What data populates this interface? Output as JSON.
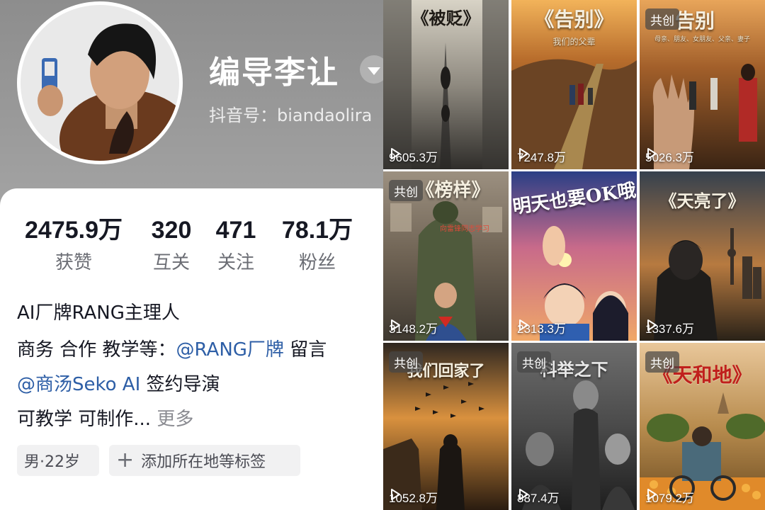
{
  "profile": {
    "display_name": "编导李让",
    "account_id": "抖音号：biandaolira",
    "stats": [
      {
        "value": "2475.9万",
        "label": "获赞"
      },
      {
        "value": "320",
        "label": "互关"
      },
      {
        "value": "471",
        "label": "关注"
      },
      {
        "value": "78.1万",
        "label": "粉丝"
      }
    ],
    "bio": {
      "line1": "AI厂牌RANG主理人",
      "line2_prefix": "商务 合作 教学等：",
      "line2_mention": "@RANG厂牌",
      "line2_suffix": " 留言",
      "line3_mention": "@商汤Seko AI",
      "line3_suffix": " 签约导演",
      "line4_text": "可教学 可制作...",
      "line4_more": " 更多"
    },
    "tags": {
      "gender_age": "男·22岁",
      "add_location": "添加所在地等标签"
    }
  },
  "videos": [
    {
      "title": "《被贬》",
      "subtitle": "",
      "badge": "",
      "plays": "9605.3万"
    },
    {
      "title": "《告别》",
      "subtitle": "我们的父辈",
      "badge": "",
      "plays": "7247.8万"
    },
    {
      "title": "告别",
      "subtitle": "母亲、朋友、女朋友、父亲、妻子",
      "badge": "共创",
      "plays": "5026.3万"
    },
    {
      "title": "《榜样》",
      "subtitle": "向雷锋同志学习",
      "badge": "共创",
      "plays": "3148.2万"
    },
    {
      "title": "明天也要OK哦",
      "subtitle": "",
      "badge": "",
      "plays": "2313.3万"
    },
    {
      "title": "《天亮了》",
      "subtitle": "",
      "badge": "",
      "plays": "1337.6万"
    },
    {
      "title": "我们回家了",
      "subtitle": "",
      "badge": "共创",
      "plays": "1052.8万"
    },
    {
      "title": "科举之下",
      "subtitle": "",
      "badge": "共创",
      "plays": "887.4万"
    },
    {
      "title": "《天和地》",
      "subtitle": "",
      "badge": "共创",
      "plays": "1079.2万"
    }
  ],
  "icons": {
    "play": "play-icon",
    "dropdown": "chevron-down-icon",
    "add": "plus-icon"
  },
  "colors": {
    "mention": "#2d5ea6",
    "header_bg": "#9a9a9a",
    "text_primary": "#161823",
    "text_secondary": "#6b6d74"
  }
}
